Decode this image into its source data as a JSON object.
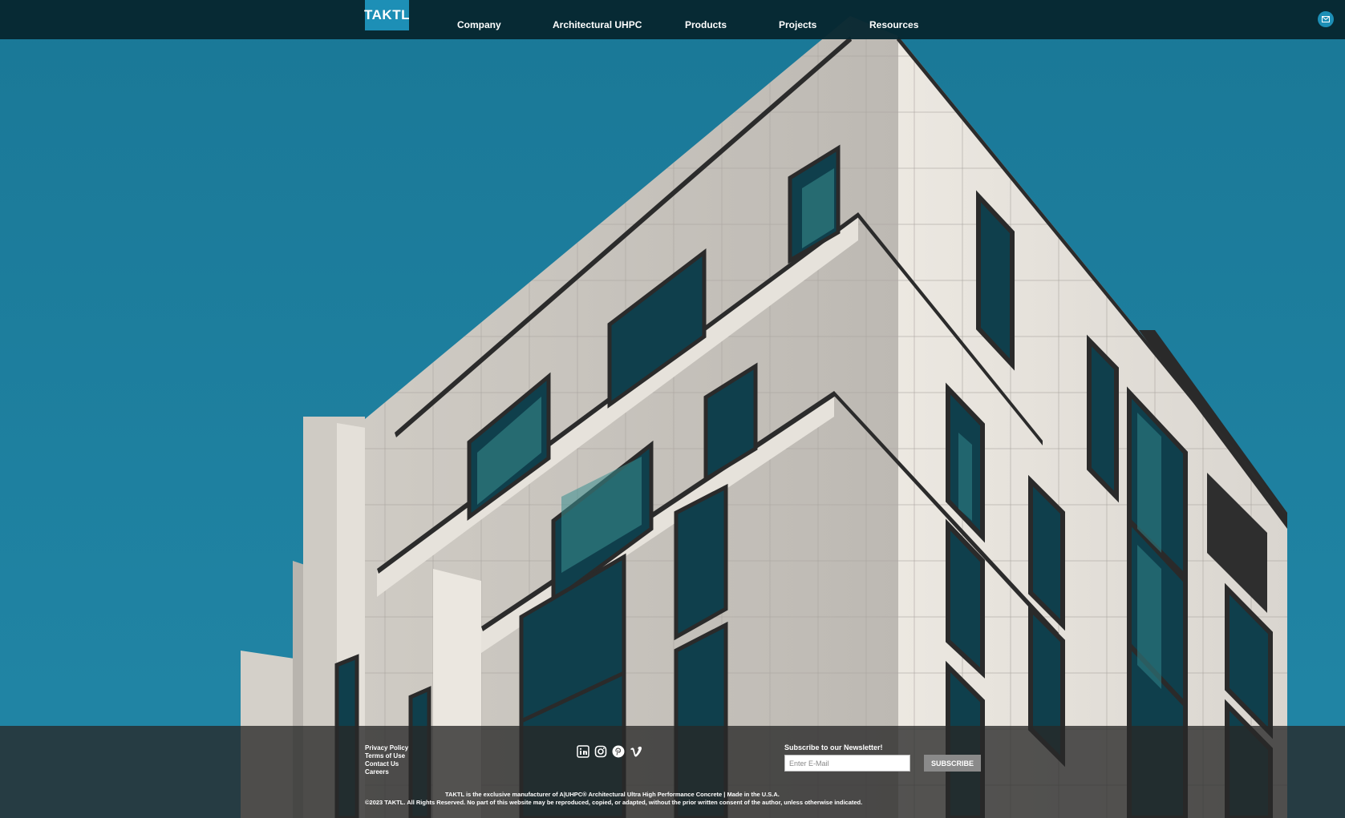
{
  "brand": {
    "logo_text": "TAKTL"
  },
  "nav": {
    "items": [
      "Company",
      "Architectural UHPC",
      "Products",
      "Projects",
      "Resources"
    ]
  },
  "header": {
    "mail_icon": "envelope-icon"
  },
  "footer": {
    "links": [
      "Privacy Policy",
      "Terms of Use",
      "Contact Us",
      "Careers"
    ],
    "social_icons": [
      "linkedin-icon",
      "instagram-icon",
      "pinterest-icon",
      "vimeo-icon"
    ],
    "newsletter": {
      "label": "Subscribe to our Newsletter!",
      "placeholder": "Enter E-Mail",
      "button": "SUBSCRIBE"
    },
    "legal_line1": "TAKTL is the exclusive manufacturer of A|UHPC® Architectural Ultra High Performance Concrete | Made in the U.S.A.",
    "legal_line2": "©2023 TAKTL. All Rights Reserved. No part of this website may be reproduced, copied, or adapted, without the prior written consent of the author, unless otherwise indicated."
  },
  "colors": {
    "sky": "#1f7a99",
    "header_bg": "#062630",
    "logo_bg": "#1d8fb6",
    "facade": "#ddd9d2"
  }
}
